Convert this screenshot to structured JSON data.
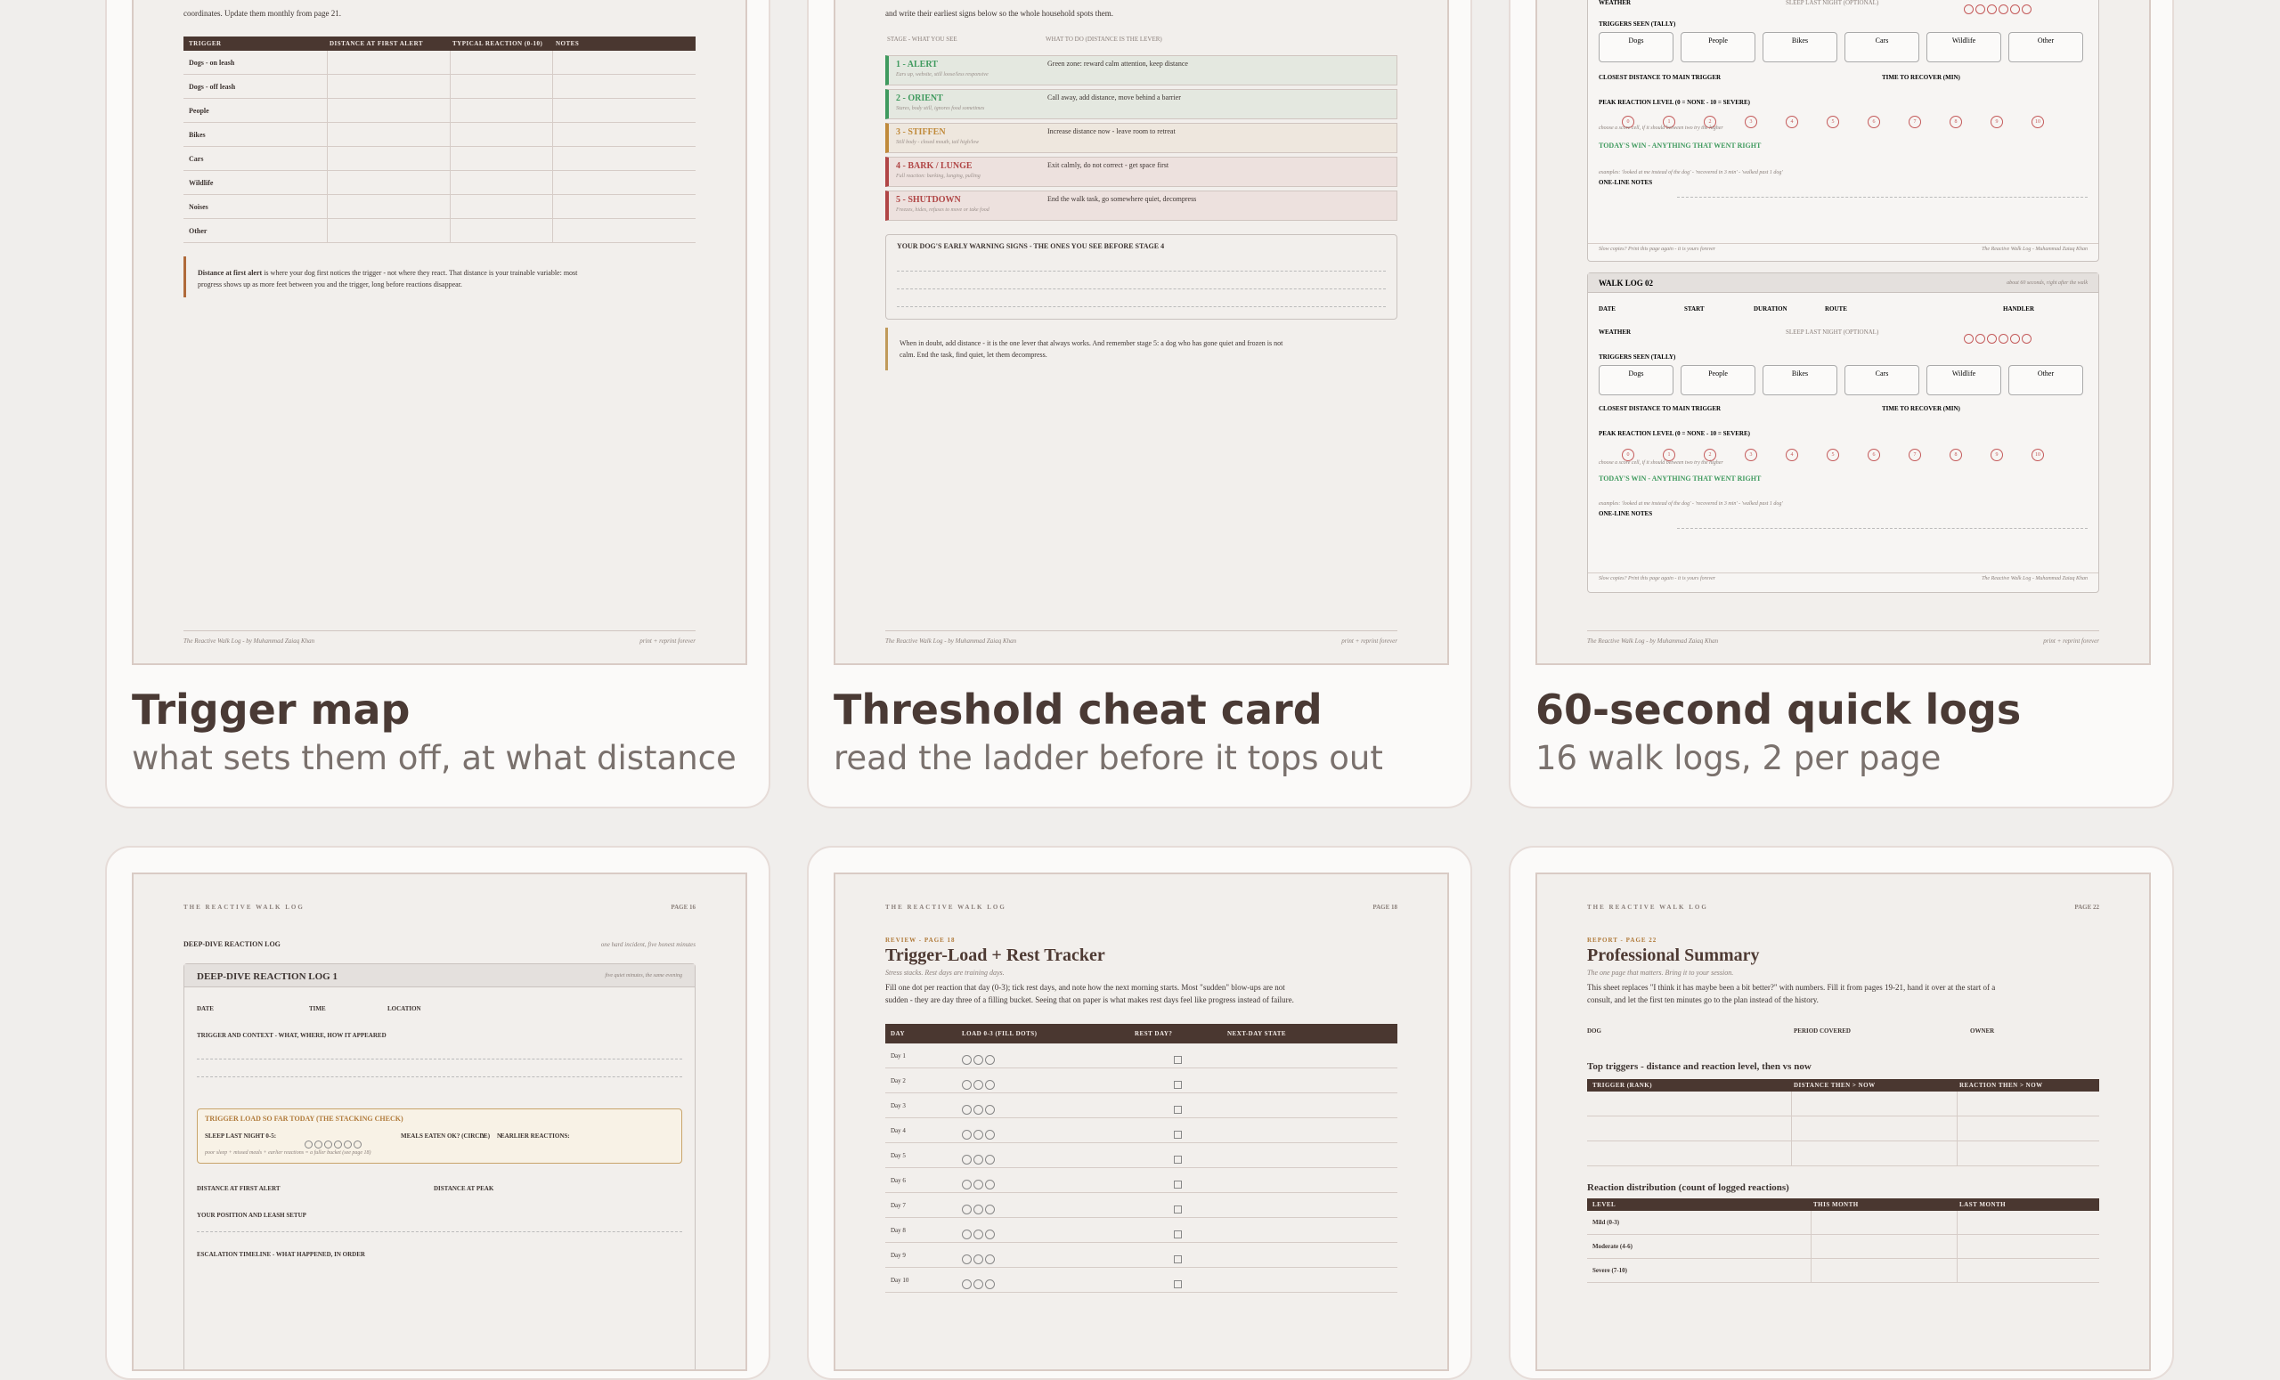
{
  "cards": [
    {
      "title": "Trigger map",
      "subtitle": "what sets them off, at what distance"
    },
    {
      "title": "Threshold cheat card",
      "subtitle": "read the ladder before it tops out"
    },
    {
      "title": "60-second quick logs",
      "subtitle": "16 walk logs, 2 per page"
    }
  ],
  "footer": {
    "left": "The Reactive Walk Log - by Muhammad Zaiaq Khan",
    "right": "print + reprint forever"
  },
  "header": {
    "brand": "THE REACTIVE WALK LOG"
  },
  "trigger_map": {
    "intro": "coordinates. Update them monthly from page 21.",
    "columns": [
      "TRIGGER",
      "DISTANCE AT FIRST ALERT",
      "TYPICAL REACTION (0-10)",
      "NOTES"
    ],
    "rows": [
      "Dogs - on leash",
      "Dogs - off leash",
      "People",
      "Bikes",
      "Cars",
      "Wildlife",
      "Noises",
      "Other"
    ],
    "note_bold": "Distance at first alert",
    "note_line1": " is where your dog first notices the trigger - not where they react. That distance is your trainable variable: most",
    "note_line2": "progress shows up as more feet between you and the trigger, long before reactions disappear."
  },
  "threshold": {
    "intro": "and write their earliest signs below so the whole household spots them.",
    "col1": "STAGE - WHAT YOU SEE",
    "col2": "WHAT TO DO (DISTANCE IS THE LEVER)",
    "levels": [
      {
        "name": "1 - ALERT",
        "desc": "Ears up, website, still loose/less responsive",
        "action": "Green zone: reward calm attention, keep distance",
        "color": "#3f9a5e"
      },
      {
        "name": "2 - ORIENT",
        "desc": "Stares, body still, ignores food sometimes",
        "action": "Call away, add distance, move behind a barrier",
        "color": "#3f9a5e"
      },
      {
        "name": "3 - STIFFEN",
        "desc": "Still body - closed mouth, tail high/low",
        "action": "Increase distance now - leave room to retreat",
        "color": "#c08a3a"
      },
      {
        "name": "4 - BARK / LUNGE",
        "desc": "Full reaction: barking, lunging, pulling",
        "action": "Exit calmly, do not correct - get space first",
        "color": "#b04545"
      },
      {
        "name": "5 - SHUTDOWN",
        "desc": "Freezes, hides, refuses to move or take food",
        "action": "End the walk task, go somewhere quiet, decompress",
        "color": "#b04545"
      }
    ],
    "warn_title": "YOUR DOG'S EARLY WARNING SIGNS - THE ONES YOU SEE BEFORE STAGE 4",
    "note_line1": "When in doubt, add distance - it is the one lever that always works. And remember stage 5: a dog who has gone quiet and frozen is not",
    "note_line2": "calm. End the task, find quiet, let them decompress."
  },
  "quick_logs": {
    "log2_title": "WALK LOG 02",
    "log2_hint": "about 60 seconds, right after the walk",
    "fields": [
      "DATE",
      "START",
      "DURATION",
      "ROUTE",
      "HANDLER"
    ],
    "weather": "WEATHER",
    "sleep": "SLEEP LAST NIGHT (OPTIONAL)",
    "triggers_seen": "TRIGGERS SEEN (TALLY)",
    "trigger_boxes": [
      "Dogs",
      "People",
      "Bikes",
      "Cars",
      "Wildlife",
      "Other"
    ],
    "closest": "CLOSEST DISTANCE TO MAIN TRIGGER",
    "recover": "TIME TO RECOVER (MIN)",
    "peak": "PEAK REACTION LEVEL (0 = NONE - 10 = SEVERE)",
    "peak_hint": "choose a score cell, if it should between two try the higher",
    "win": "TODAY'S WIN - ANYTHING THAT WENT RIGHT",
    "win_hint": "examples: 'looked at me instead of the dog' - 'recovered in 3 min' - 'walked past 1 dog'",
    "notes": "ONE-LINE NOTES",
    "foot_left": "Slow copies? Print this page again - it is yours forever",
    "foot_right": "The Reactive Walk Log - Muhammad Zaiaq Khan",
    "scale": [
      "0",
      "1",
      "2",
      "3",
      "4",
      "5",
      "6",
      "7",
      "8",
      "9",
      "10"
    ]
  },
  "deep_dive": {
    "page": "PAGE 16",
    "heading": "DEEP-DIVE REACTION LOG",
    "hint": "one hard incident, five honest minutes",
    "box_title": "DEEP-DIVE REACTION LOG 1",
    "box_hint": "five quiet minutes, the same evening",
    "date": "DATE",
    "time": "TIME",
    "location": "LOCATION",
    "trigger_context": "TRIGGER AND CONTEXT - WHAT, WHERE, HOW IT APPEARED",
    "load_title": "TRIGGER LOAD SO FAR TODAY (THE STACKING CHECK)",
    "sleep": "SLEEP LAST NIGHT 0-5:",
    "meals": "MEALS EATEN OK? (CIRCLE)",
    "y": "Y",
    "n": "N",
    "earlier": "EARLIER REACTIONS:",
    "load_hint": "poor sleep + missed meals + earlier reactions = a fuller bucket (see page 18)",
    "first_alert": "DISTANCE AT FIRST ALERT",
    "at_peak": "DISTANCE AT PEAK",
    "position": "YOUR POSITION AND LEASH SETUP",
    "escalation": "ESCALATION TIMELINE - WHAT HAPPENED, IN ORDER"
  },
  "tracker": {
    "page": "PAGE 18",
    "kicker": "REVIEW - PAGE 18",
    "title": "Trigger-Load + Rest Tracker",
    "sub": "Stress stacks. Rest days are training days.",
    "para1": "Fill one dot per reaction that day (0-3); tick rest days, and note how the next morning starts. Most \"sudden\" blow-ups are not",
    "para2": "sudden - they are day three of a filling bucket. Seeing that on paper is what makes rest days feel like progress instead of failure.",
    "columns": [
      "DAY",
      "LOAD 0-3 (FILL DOTS)",
      "REST DAY?",
      "NEXT-DAY STATE"
    ],
    "days": [
      "Day 1",
      "Day 2",
      "Day 3",
      "Day 4",
      "Day 5",
      "Day 6",
      "Day 7",
      "Day 8",
      "Day 9",
      "Day 10"
    ]
  },
  "summary": {
    "page": "PAGE 22",
    "kicker": "REPORT - PAGE 22",
    "title": "Professional Summary",
    "sub": "The one page that matters. Bring it to your session.",
    "para1": "This sheet replaces \"I think it has maybe been a bit better?\" with numbers. Fill it from pages 19-21, hand it over at the start of a",
    "para2": "consult, and let the first ten minutes go to the plan instead of the history.",
    "fields": [
      "DOG",
      "PERIOD COVERED",
      "OWNER"
    ],
    "h1": "Top triggers - distance and reaction level, then vs now",
    "cols1": [
      "TRIGGER (RANK)",
      "DISTANCE THEN > NOW",
      "REACTION THEN > NOW"
    ],
    "h2": "Reaction distribution (count of logged reactions)",
    "cols2": [
      "LEVEL",
      "THIS MONTH",
      "LAST MONTH"
    ],
    "levels": [
      "Mild (0-3)",
      "Moderate (4-6)",
      "Severe (7-10)"
    ]
  }
}
